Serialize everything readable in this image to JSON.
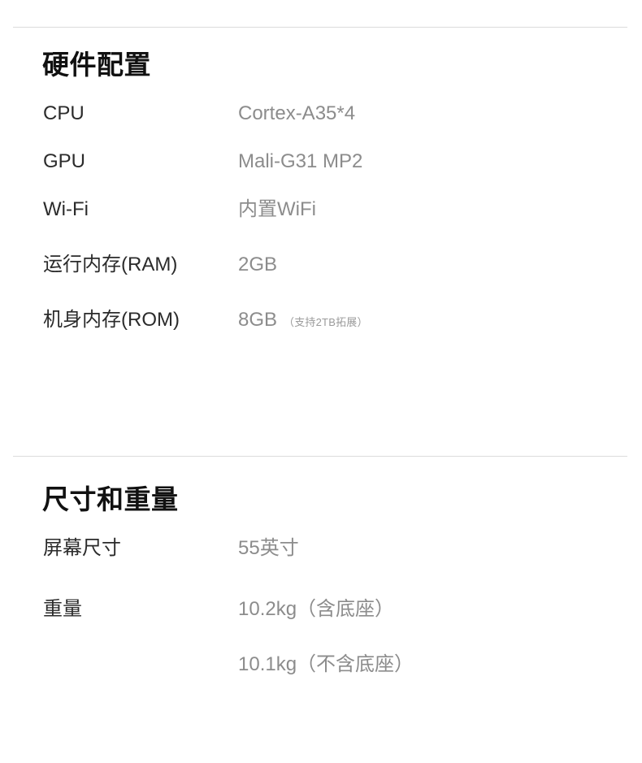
{
  "page": {
    "background_color": "#ffffff",
    "divider_color": "#dcdcdc",
    "label_color": "#2b2b2b",
    "value_color": "#8c8c8c",
    "note_color": "#9a9a9a"
  },
  "sections": [
    {
      "title": "硬件配置",
      "rows": [
        {
          "label": "CPU",
          "value": "Cortex-A35*4",
          "note": ""
        },
        {
          "label": "GPU",
          "value": "Mali-G31 MP2",
          "note": ""
        },
        {
          "label": "Wi-Fi",
          "value": "内置WiFi",
          "note": ""
        },
        {
          "label": "运行内存(RAM)",
          "value": "2GB",
          "note": ""
        },
        {
          "label": "机身内存(ROM)",
          "value": "8GB",
          "note": "（支持2TB拓展）"
        }
      ]
    },
    {
      "title": "尺寸和重量",
      "rows": [
        {
          "label": "屏幕尺寸",
          "value": "55英寸",
          "note": ""
        },
        {
          "label": "重量",
          "value": "10.2kg（含底座）",
          "note": ""
        },
        {
          "label": "",
          "value": "10.1kg（不含底座）",
          "note": ""
        }
      ]
    }
  ]
}
